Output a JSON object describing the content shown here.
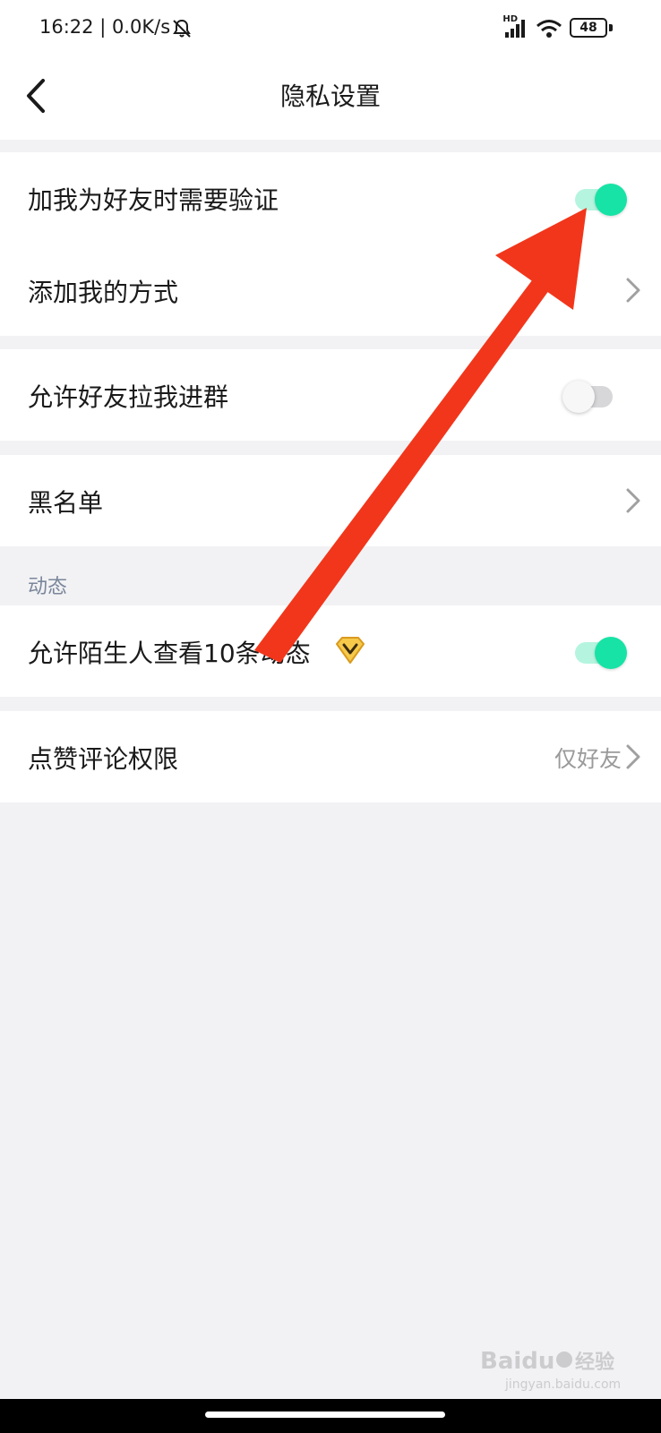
{
  "status_bar": {
    "time_speed": "16:22 | 0.0K/s",
    "network": "HD",
    "battery": "48",
    "icons": [
      "bell-muted-icon",
      "signal-icon",
      "wifi-icon",
      "battery-icon"
    ]
  },
  "header": {
    "title": "隐私设置",
    "back_icon": "chevron-left-icon"
  },
  "settings": {
    "friend_verification": {
      "label": "加我为好友时需要验证",
      "enabled": true
    },
    "add_me_methods": {
      "label": "添加我的方式"
    },
    "allow_group_invite": {
      "label": "允许好友拉我进群",
      "enabled": false
    },
    "blacklist": {
      "label": "黑名单"
    }
  },
  "moments": {
    "header": "动态",
    "stranger_view": {
      "label": "允许陌生人查看10条动态",
      "enabled": true,
      "badge_icon": "vip-badge-icon"
    }
  },
  "like_comment": {
    "label": "点赞评论权限",
    "value": "仅好友"
  },
  "watermark": {
    "text": "Baidu经验",
    "subtext": "jingyan.baidu.com"
  },
  "colors": {
    "accent": "#17e3a6",
    "accent_track": "#b5f5df",
    "annotation_arrow": "#f2361b",
    "background": "#f2f2f4"
  }
}
